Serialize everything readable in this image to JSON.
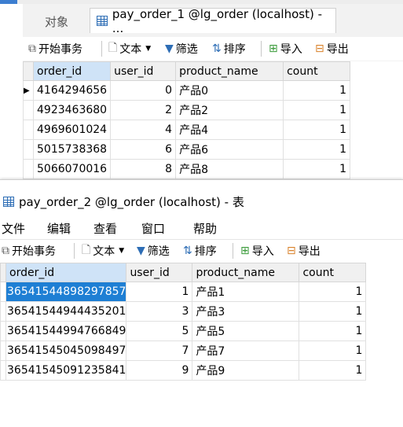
{
  "top": {
    "tabs": [
      {
        "label": "对象"
      },
      {
        "label": "pay_order_1 @lg_order (localhost) - ..."
      }
    ],
    "toolbar": {
      "begin_tx": "开始事务",
      "text": "文本",
      "filter": "筛选",
      "sort": "排序",
      "import": "导入",
      "export": "导出"
    },
    "columns": [
      "order_id",
      "user_id",
      "product_name",
      "count"
    ],
    "rows": [
      {
        "order_id": "4164294656",
        "user_id": "0",
        "product_name": "产品0",
        "count": "1"
      },
      {
        "order_id": "4923463680",
        "user_id": "2",
        "product_name": "产品2",
        "count": "1"
      },
      {
        "order_id": "4969601024",
        "user_id": "4",
        "product_name": "产品4",
        "count": "1"
      },
      {
        "order_id": "5015738368",
        "user_id": "6",
        "product_name": "产品6",
        "count": "1"
      },
      {
        "order_id": "5066070016",
        "user_id": "8",
        "product_name": "产品8",
        "count": "1"
      }
    ]
  },
  "bottom": {
    "title": "pay_order_2 @lg_order (localhost) - 表",
    "menu": [
      "文件",
      "编辑",
      "查看",
      "窗口",
      "帮助"
    ],
    "toolbar": {
      "begin_tx": "开始事务",
      "text": "文本",
      "filter": "筛选",
      "sort": "排序",
      "import": "导入",
      "export": "导出"
    },
    "columns": [
      "order_id",
      "user_id",
      "product_name",
      "count"
    ],
    "rows": [
      {
        "order_id": "36541544898297857",
        "user_id": "1",
        "product_name": "产品1",
        "count": "1"
      },
      {
        "order_id": "36541544944435201",
        "user_id": "3",
        "product_name": "产品3",
        "count": "1"
      },
      {
        "order_id": "36541544994766849",
        "user_id": "5",
        "product_name": "产品5",
        "count": "1"
      },
      {
        "order_id": "36541545045098497",
        "user_id": "7",
        "product_name": "产品7",
        "count": "1"
      },
      {
        "order_id": "36541545091235841",
        "user_id": "9",
        "product_name": "产品9",
        "count": "1"
      }
    ]
  },
  "colors": {
    "accent": "#1e7fd4",
    "icon_blue": "#2d6db5",
    "import_green": "#3a9a3a",
    "export_orange": "#d9822b"
  }
}
